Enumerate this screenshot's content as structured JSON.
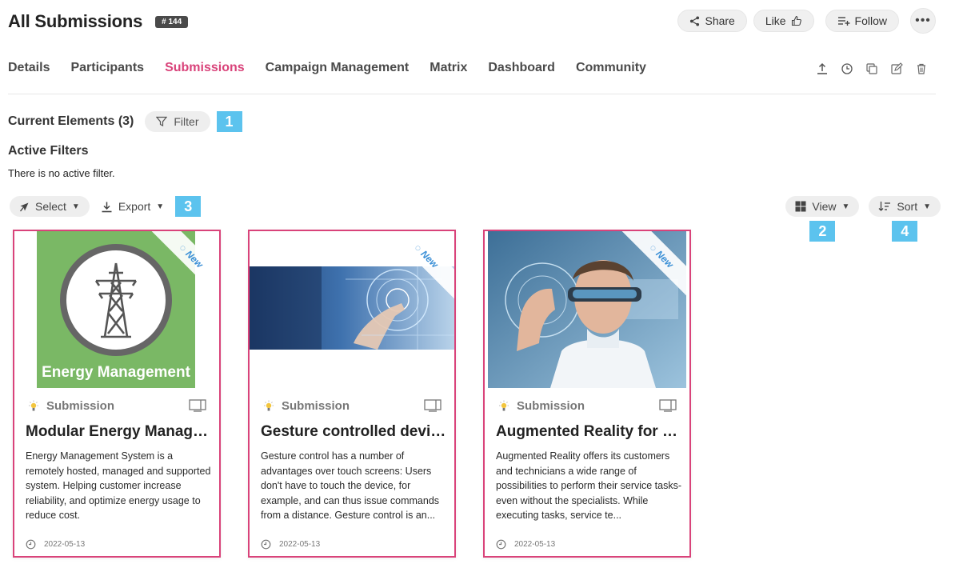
{
  "header": {
    "title": "All Submissions",
    "id_badge": "# 144",
    "share_label": "Share",
    "like_label": "Like",
    "follow_label": "Follow",
    "more_label": "•••"
  },
  "tabs": [
    {
      "label": "Details"
    },
    {
      "label": "Participants"
    },
    {
      "label": "Submissions",
      "active": true
    },
    {
      "label": "Campaign Management"
    },
    {
      "label": "Matrix"
    },
    {
      "label": "Dashboard"
    },
    {
      "label": "Community"
    }
  ],
  "tab_tools": [
    "upload-icon",
    "clock-icon",
    "copy-icon",
    "edit-icon",
    "trash-icon"
  ],
  "elements": {
    "title": "Current Elements (3)",
    "filter_label": "Filter"
  },
  "filters": {
    "title": "Active Filters",
    "empty_text": "There is no active filter."
  },
  "toolbar": {
    "select_label": "Select",
    "export_label": "Export",
    "view_label": "View",
    "sort_label": "Sort"
  },
  "badges": {
    "filter": "1",
    "view": "2",
    "export": "3",
    "sort": "4"
  },
  "cards": [
    {
      "ribbon": "New",
      "image_caption": "Energy Management",
      "type": "Submission",
      "title": "Modular Energy Manag…",
      "description": "Energy Management System is a remotely hosted, managed and supported system. Helping customer increase reliability, and optimize energy usage to reduce cost.",
      "date": "2022-05-13"
    },
    {
      "ribbon": "New",
      "type": "Submission",
      "title": "Gesture controlled devi…",
      "description": "Gesture control has a number of advantages over touch screens: Users don't have to touch the device, for example, and can thus issue commands from a distance. Gesture control is an...",
      "date": "2022-05-13"
    },
    {
      "ribbon": "New",
      "type": "Submission",
      "title": "Augmented Reality for …",
      "description": "Augmented Reality offers its customers and technicians a wide range of possibilities to perform their service tasks- even without the specialists. While executing tasks, service te...",
      "date": "2022-05-13"
    }
  ],
  "colors": {
    "accent": "#d9437a",
    "badge": "#5cc3ee",
    "ribbon_text": "#3a8fd6",
    "energy_bg": "#7ab865"
  }
}
